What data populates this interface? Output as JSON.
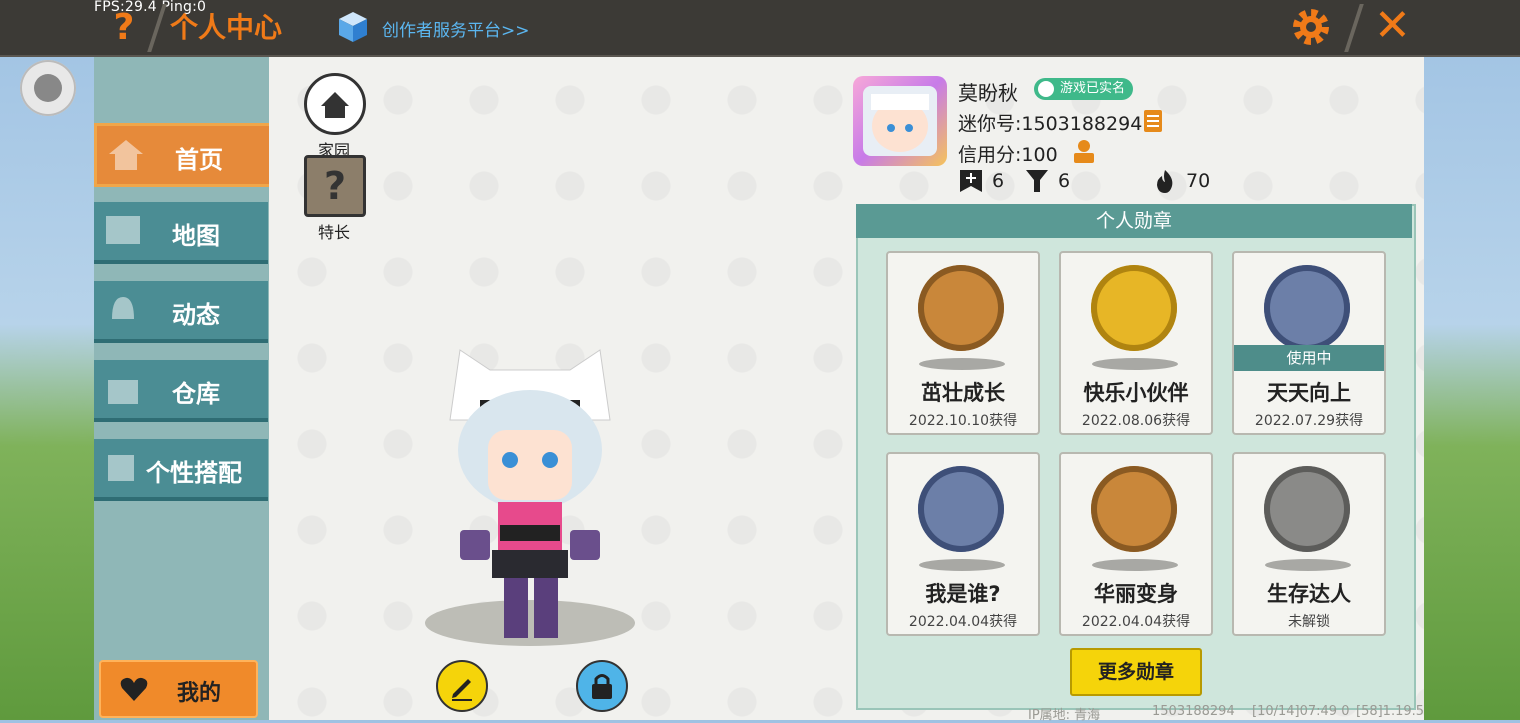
{
  "debug": {
    "fps": "FPS:29.4  Ping:0"
  },
  "header": {
    "help": "?",
    "title": "个人中心",
    "creator_link": "创作者服务平台>>",
    "close": "✕"
  },
  "nav": {
    "items": [
      {
        "label": "首页",
        "active": true
      },
      {
        "label": "地图",
        "active": false
      },
      {
        "label": "动态",
        "active": false
      },
      {
        "label": "仓库",
        "active": false
      },
      {
        "label": "个性搭配",
        "active": false
      }
    ],
    "mine": "我的"
  },
  "side": {
    "home": "家园",
    "talent_icon": "?",
    "talent": "特长"
  },
  "profile": {
    "name": "莫盼秋",
    "verified": "游戏已实名",
    "mini_id": "迷你号:1503188294",
    "credit": "信用分:100",
    "stats": {
      "flag": "6",
      "cheer": "6",
      "fire": "70"
    }
  },
  "medals": {
    "title": "个人勋章",
    "items": [
      {
        "name": "茁壮成长",
        "date": "2022.10.10获得",
        "color": "#c9873a"
      },
      {
        "name": "快乐小伙伴",
        "date": "2022.08.06获得",
        "color": "#e7b626"
      },
      {
        "name": "天天向上",
        "date": "2022.07.29获得",
        "color": "#6c7fa8",
        "badge": "使用中"
      },
      {
        "name": "我是谁?",
        "date": "2022.04.04获得",
        "color": "#6c7fa8"
      },
      {
        "name": "华丽变身",
        "date": "2022.04.04获得",
        "color": "#c9873a"
      },
      {
        "name": "生存达人",
        "date": "未解锁",
        "color": "#8a8a88"
      }
    ],
    "more": "更多勋章"
  },
  "footer": {
    "location": "IP属地: 青海",
    "id": "1503188294",
    "time": "[10/14]07:49 0",
    "version": "[58]1.19.5"
  }
}
